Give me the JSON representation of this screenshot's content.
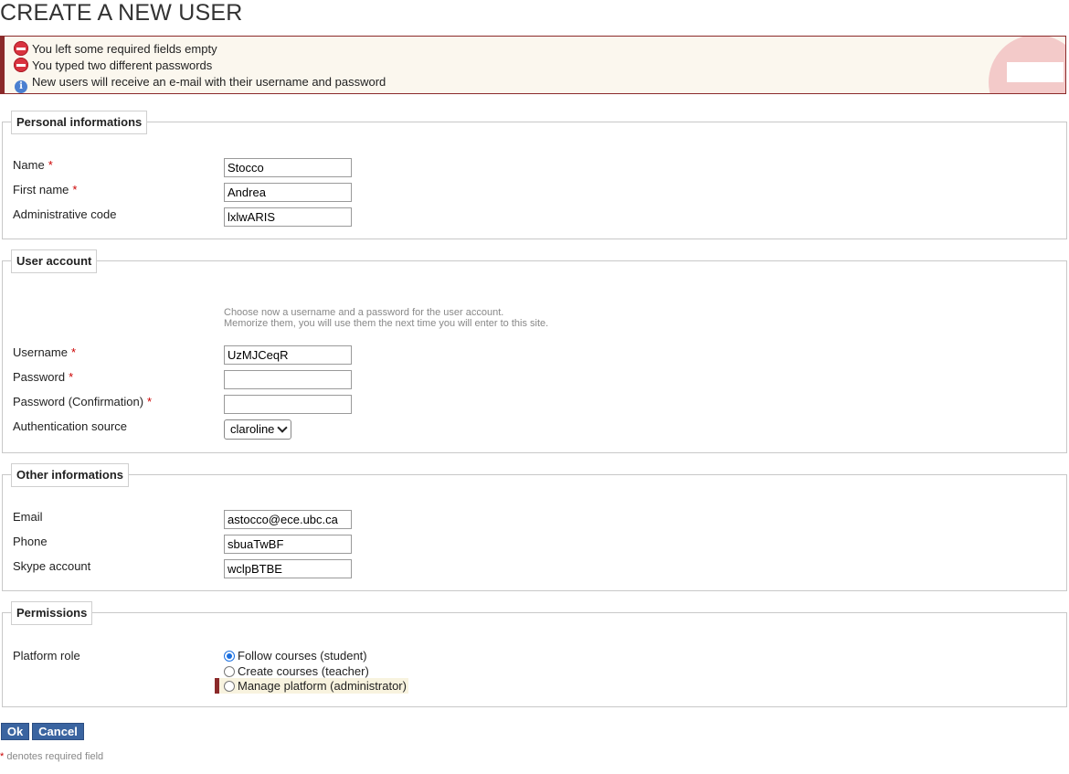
{
  "page_title": "CREATE A NEW USER",
  "messages": [
    {
      "type": "error",
      "icon": "error-icon",
      "text": "You left some required fields empty"
    },
    {
      "type": "error",
      "icon": "error-icon",
      "text": "You typed two different passwords"
    },
    {
      "type": "info",
      "icon": "info-icon",
      "text": "New users will receive an e-mail with their username and password"
    }
  ],
  "personal": {
    "legend": "Personal informations",
    "name_label": "Name",
    "name_value": "Stocco",
    "firstname_label": "First name",
    "firstname_value": "Andrea",
    "admin_code_label": "Administrative code",
    "admin_code_value": "lxlwARIS"
  },
  "account": {
    "legend": "User account",
    "hint_line1": "Choose now a username and a password for the user account.",
    "hint_line2": "Memorize them, you will use them the next time you will enter to this site.",
    "username_label": "Username",
    "username_value": "UzMJCeqR",
    "password_label": "Password",
    "password_value": "",
    "password_confirm_label": "Password (Confirmation)",
    "password_confirm_value": "",
    "auth_source_label": "Authentication source",
    "auth_source_value": "claroline"
  },
  "other": {
    "legend": "Other informations",
    "email_label": "Email",
    "email_value": "astocco@ece.ubc.ca",
    "phone_label": "Phone",
    "phone_value": "sbuaTwBF",
    "skype_label": "Skype account",
    "skype_value": "wclpBTBE"
  },
  "permissions": {
    "legend": "Permissions",
    "role_label": "Platform role",
    "options": [
      {
        "label": "Follow courses (student)",
        "selected": true
      },
      {
        "label": "Create courses (teacher)",
        "selected": false
      },
      {
        "label": "Manage platform (administrator)",
        "selected": false
      }
    ]
  },
  "required_marker": "*",
  "buttons": {
    "ok": "Ok",
    "cancel": "Cancel"
  },
  "footnote": "denotes required field",
  "colors": {
    "accent": "#3a64a0",
    "error": "#d9333f",
    "required": "#cc0000",
    "message_border": "#8b2a2a"
  }
}
